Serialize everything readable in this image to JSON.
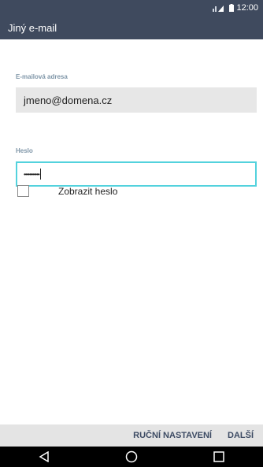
{
  "status_bar": {
    "time": "12:00"
  },
  "header": {
    "title": "Jiný e-mail"
  },
  "form": {
    "email_label": "E-mailová adresa",
    "email_value": "jmeno@domena.cz",
    "password_label": "Heslo",
    "password_value": "•••••••••••",
    "show_password_label": "Zobrazit heslo"
  },
  "actions": {
    "manual_label": "RUČNÍ NASTAVENÍ",
    "next_label": "DALŠÍ"
  },
  "nav": {
    "icons": [
      "back-icon",
      "home-icon",
      "recents-icon"
    ]
  },
  "colors": {
    "header_bg": "#3f4a5e",
    "field_focus": "#53d2dd",
    "action_text": "#3c4a63"
  }
}
